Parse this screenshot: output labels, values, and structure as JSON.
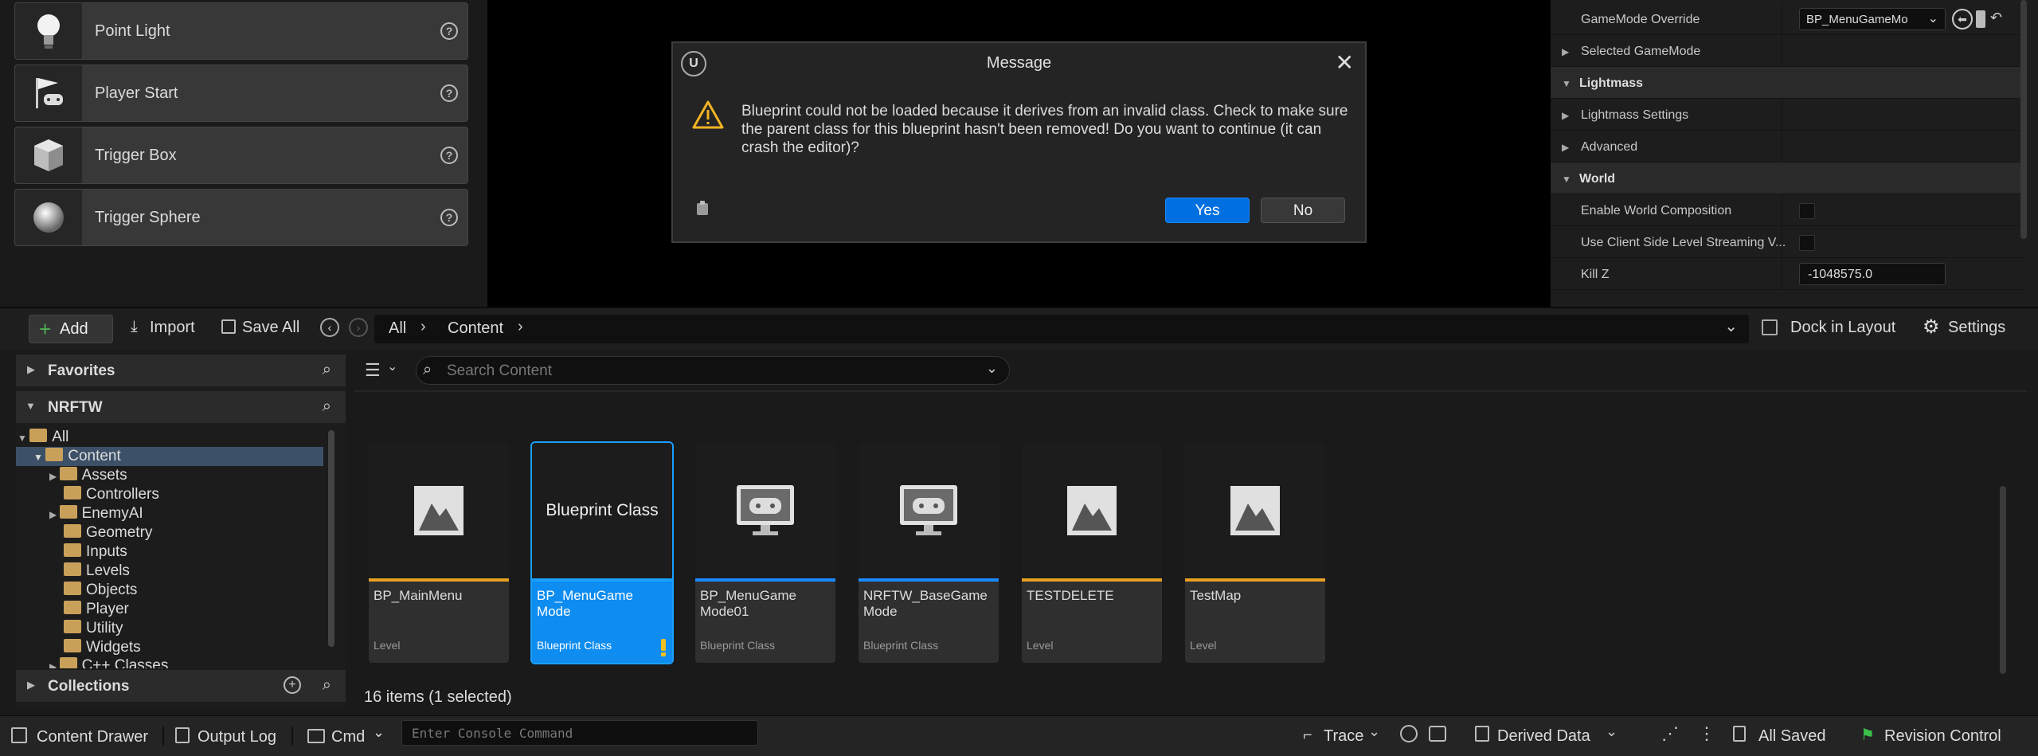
{
  "placement": {
    "items": [
      {
        "label": "Point Light",
        "icon": "lightbulb-icon"
      },
      {
        "label": "Player Start",
        "icon": "flag-controller-icon"
      },
      {
        "label": "Trigger Box",
        "icon": "cube-icon"
      },
      {
        "label": "Trigger Sphere",
        "icon": "sphere-icon"
      }
    ],
    "help_glyph": "?"
  },
  "details": {
    "rows": [
      {
        "label": "GameMode Override",
        "type": "combo",
        "value": "BP_MenuGameMo"
      },
      {
        "label": "Selected GameMode",
        "type": "collapsed"
      },
      {
        "label": "Lightmass",
        "type": "section"
      },
      {
        "label": "Lightmass Settings",
        "type": "collapsed"
      },
      {
        "label": "Advanced",
        "type": "collapsed"
      },
      {
        "label": "World",
        "type": "section"
      },
      {
        "label": "Enable World Composition",
        "type": "checkbox",
        "checked": false
      },
      {
        "label": "Use Client Side Level Streaming V...",
        "type": "checkbox",
        "checked": false
      },
      {
        "label": "Kill Z",
        "type": "number",
        "value": "-1048575.0"
      }
    ]
  },
  "dialog": {
    "title": "Message",
    "logo": "U",
    "close": "✕",
    "message": "Blueprint could not be loaded because it derives from an invalid class.  Check to make sure the parent class for this blueprint hasn't been removed! Do you want to continue (it can crash the editor)?",
    "yes_label": "Yes",
    "no_label": "No",
    "colors": {
      "warning": "#f0b323",
      "primary": "#0070e0"
    }
  },
  "toolbar": {
    "add_label": "Add",
    "import_label": "Import",
    "save_all_label": "Save All",
    "breadcrumb": [
      "All",
      "Content"
    ],
    "dock_label": "Dock in Layout",
    "settings_label": "Settings"
  },
  "sidebar": {
    "favorites_label": "Favorites",
    "project_label": "NRFTW",
    "tree": [
      {
        "label": "All",
        "depth": 0,
        "expanded": true
      },
      {
        "label": "Content",
        "depth": 1,
        "expanded": true,
        "selected": true
      },
      {
        "label": "Assets",
        "depth": 2,
        "has_children": true
      },
      {
        "label": "Controllers",
        "depth": 2
      },
      {
        "label": "EnemyAI",
        "depth": 2,
        "has_children": true
      },
      {
        "label": "Geometry",
        "depth": 2
      },
      {
        "label": "Inputs",
        "depth": 2
      },
      {
        "label": "Levels",
        "depth": 2
      },
      {
        "label": "Objects",
        "depth": 2
      },
      {
        "label": "Player",
        "depth": 2
      },
      {
        "label": "Utility",
        "depth": 2
      },
      {
        "label": "Widgets",
        "depth": 2
      },
      {
        "label": "C++ Classes",
        "depth": 1
      }
    ],
    "collections_label": "Collections"
  },
  "content": {
    "search_placeholder": "Search Content",
    "item_count": "16 items (1 selected)",
    "assets": [
      {
        "name": "BP_MainMenu",
        "type": "Level",
        "thumb": "level-icon",
        "bar_color": "#e8a020",
        "selected": false
      },
      {
        "name": "BP_MenuGame Mode",
        "type": "Blueprint Class",
        "thumb_text": "Blueprint Class",
        "bar_color": "#1aa0ff",
        "selected": true,
        "warning": true
      },
      {
        "name": "BP_MenuGame Mode01",
        "type": "Blueprint Class",
        "thumb": "gamemode-icon",
        "bar_color": "#1a8aff",
        "selected": false
      },
      {
        "name": "NRFTW_BaseGame Mode",
        "type": "Blueprint Class",
        "thumb": "gamemode-icon",
        "bar_color": "#1a8aff",
        "selected": false
      },
      {
        "name": "TESTDELETE",
        "type": "Level",
        "thumb": "level-icon",
        "bar_color": "#e8a020",
        "selected": false
      },
      {
        "name": "TestMap",
        "type": "Level",
        "thumb": "level-icon",
        "bar_color": "#e8a020",
        "selected": false
      }
    ]
  },
  "statusbar": {
    "content_drawer": "Content Drawer",
    "output_log": "Output Log",
    "cmd": "Cmd",
    "console_placeholder": "Enter Console Command",
    "trace": "Trace",
    "derived_data": "Derived Data",
    "all_saved": "All Saved",
    "revision_control": "Revision Control"
  }
}
